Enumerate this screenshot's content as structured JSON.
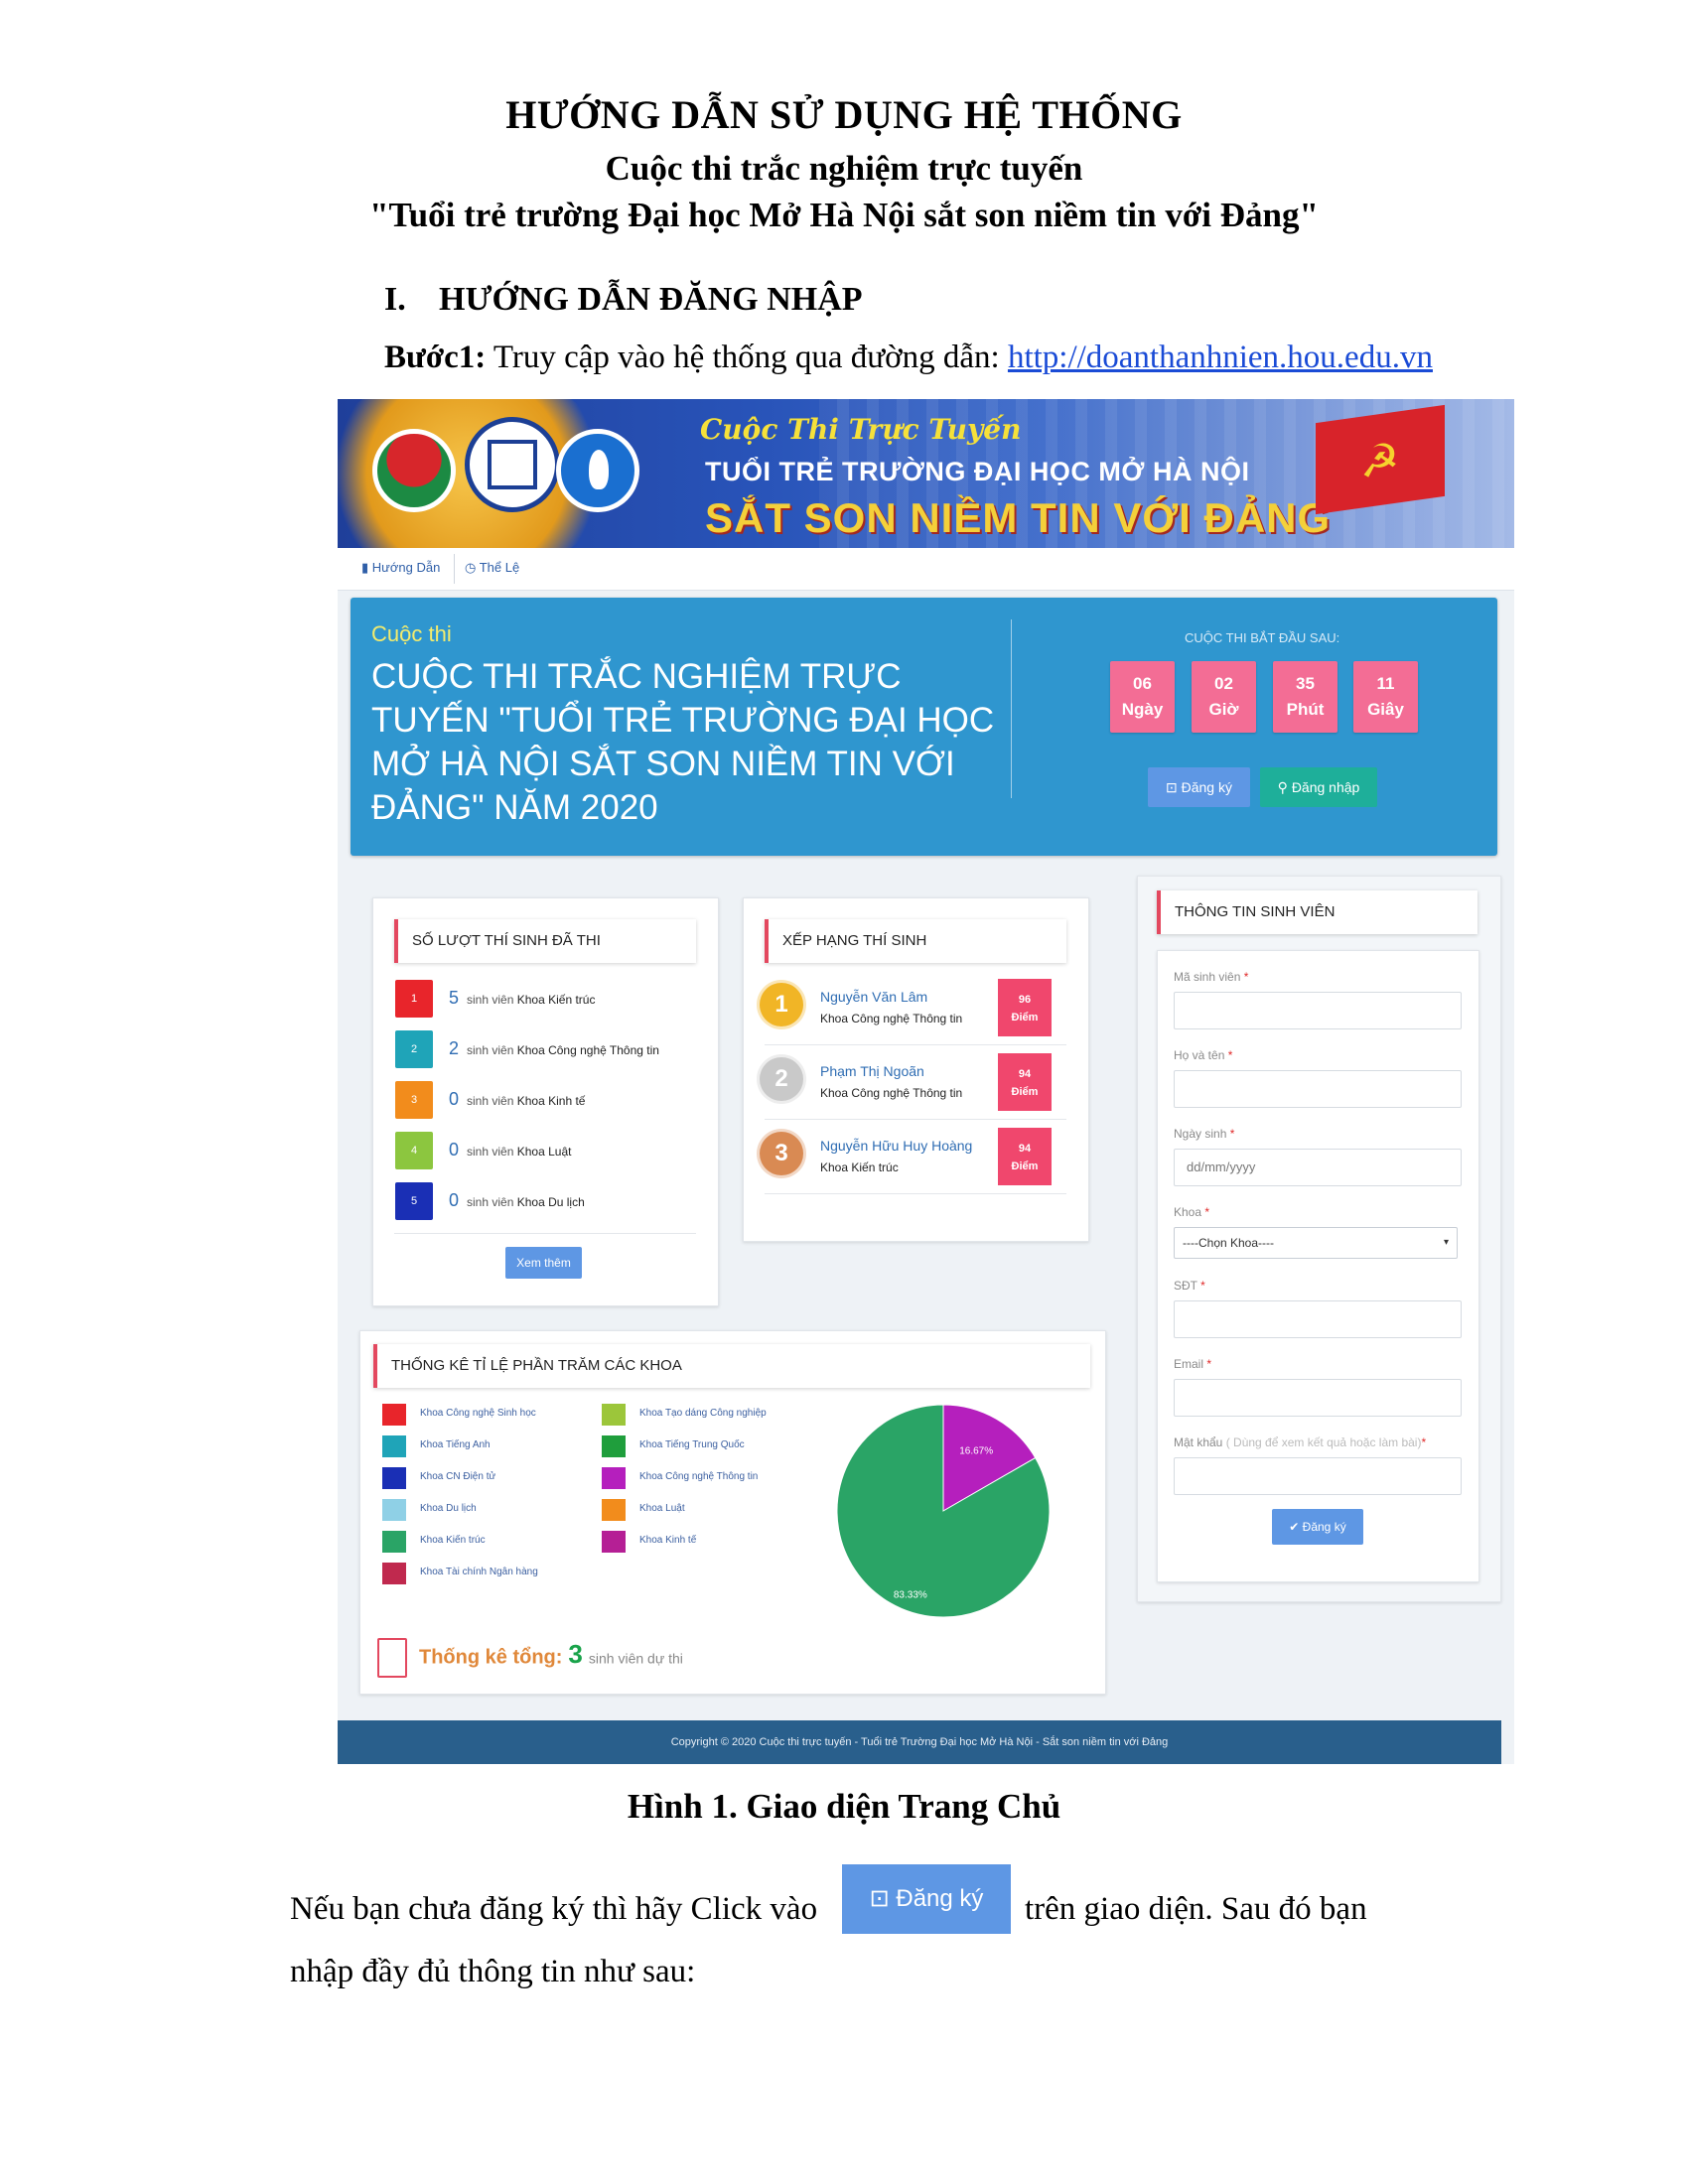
{
  "doc": {
    "title": "HƯỚNG DẪN SỬ DỤNG HỆ THỐNG",
    "subtitle": "Cuộc thi trắc nghiệm trực tuyến",
    "subtitle2": "\"Tuổi trẻ trường Đại học Mở Hà Nội sắt son niềm tin với Đảng\"",
    "section_num": "I.",
    "section_title": "HƯỚNG DẪN ĐĂNG NHẬP",
    "step_label": "Bước1:",
    "step_text": " Truy cập vào hệ thống qua đường dẫn: ",
    "step_link": "http://doanthanhnien.hou.edu.vn",
    "caption": "Hình  1. Giao diện Trang Chủ",
    "para1_a": "Nếu bạn chưa đăng ký thì hãy Click vào",
    "para1_b": "trên giao diện. Sau đó bạn",
    "para2": "nhập đầy đủ thông tin như sau:",
    "inline_button": "Đăng ký"
  },
  "banner": {
    "sub": "Cuộc Thi Trực Tuyến",
    "line1": "TUỔI TRẺ TRƯỜNG ĐẠI HỌC MỞ HÀ NỘI",
    "line2": "SẮT SON NIỀM TIN VỚI ĐẢNG"
  },
  "nav": {
    "guide": "Hướng Dẫn",
    "rules": "Thể Lệ"
  },
  "hero": {
    "label": "Cuộc thi",
    "title": "CUỘC THI TRẮC NGHIỆM TRỰC TUYẾN \"TUỔI TRẺ TRƯỜNG ĐẠI HỌC MỞ HÀ NỘI SẮT SON NIỀM TIN VỚI ĐẢNG\" NĂM 2020",
    "countdown_label": "CUỘC THI BẮT ĐẦU SAU:",
    "countdown": [
      {
        "value": "06",
        "unit": "Ngày"
      },
      {
        "value": "02",
        "unit": "Giờ"
      },
      {
        "value": "35",
        "unit": "Phút"
      },
      {
        "value": "11",
        "unit": "Giây"
      }
    ],
    "register": "Đăng ký",
    "login": "Đăng nhập"
  },
  "stats": {
    "title": "SỐ LƯỢT THÍ SINH ĐÃ THI",
    "unit": "sinh viên",
    "rows": [
      {
        "idx": "1",
        "count": "5",
        "faculty": "Khoa Kiến trúc",
        "color": "#e8252b"
      },
      {
        "idx": "2",
        "count": "2",
        "faculty": "Khoa Công nghệ Thông tin",
        "color": "#1fa4b8"
      },
      {
        "idx": "3",
        "count": "0",
        "faculty": "Khoa Kinh tế",
        "color": "#f28c1c"
      },
      {
        "idx": "4",
        "count": "0",
        "faculty": "Khoa Luật",
        "color": "#8cc63f"
      },
      {
        "idx": "5",
        "count": "0",
        "faculty": "Khoa Du lịch",
        "color": "#1a2fb5"
      }
    ],
    "more": "Xem thêm"
  },
  "ranking": {
    "title": "XẾP HẠNG THÍ SINH",
    "points_unit": "Điểm",
    "rows": [
      {
        "rank": "1",
        "name": "Nguyễn Văn Lâm",
        "faculty": "Khoa Công nghệ Thông tin",
        "score": "96",
        "color": "#f1b526"
      },
      {
        "rank": "2",
        "name": "Phạm Thị Ngoãn",
        "faculty": "Khoa Công nghệ Thông tin",
        "score": "94",
        "color": "#c9c9c9"
      },
      {
        "rank": "3",
        "name": "Nguyễn Hữu Huy Hoàng",
        "faculty": "Khoa Kiến trúc",
        "score": "94",
        "color": "#d98a53"
      }
    ]
  },
  "student": {
    "title": "THÔNG TIN SINH VIÊN",
    "fields": [
      {
        "label": "Mã sinh viên",
        "placeholder": ""
      },
      {
        "label": "Họ và tên",
        "placeholder": ""
      },
      {
        "label": "Ngày sinh",
        "placeholder": "dd/mm/yyyy"
      },
      {
        "label": "Khoa",
        "placeholder": "----Chọn Khoa----"
      },
      {
        "label": "SĐT",
        "placeholder": ""
      },
      {
        "label": "Email",
        "placeholder": ""
      },
      {
        "label": "Mật khẩu",
        "placeholder": ""
      }
    ],
    "password_hint": "( Dùng để xem kết quả hoặc làm bài)",
    "required_mark": "*",
    "submit": "Đăng ký"
  },
  "percent": {
    "title": "THỐNG KÊ TỈ LỆ PHẦN TRĂM CÁC KHOA",
    "legend": [
      {
        "label": "Khoa Công nghệ Sinh học",
        "color": "#e8252b"
      },
      {
        "label": "Khoa Tiếng Anh",
        "color": "#1fa4b8"
      },
      {
        "label": "Khoa CN Điện tử",
        "color": "#1a2fb5"
      },
      {
        "label": "Khoa Du lịch",
        "color": "#8fd0e6"
      },
      {
        "label": "Khoa Kiến trúc",
        "color": "#2aa466"
      },
      {
        "label": "Khoa Tài chính Ngân hàng",
        "color": "#c0294e"
      },
      {
        "label": "Khoa Tạo dáng Công nghiệp",
        "color": "#9cc63a"
      },
      {
        "label": "Khoa Tiếng Trung Quốc",
        "color": "#1f9e3c"
      },
      {
        "label": "Khoa Công nghệ Thông tin",
        "color": "#b51fbd"
      },
      {
        "label": "Khoa Luật",
        "color": "#f28c1c"
      },
      {
        "label": "Khoa Kinh tế",
        "color": "#b51f95"
      }
    ],
    "total_label": "Thống kê tổng:",
    "total_value": "3",
    "total_unit": "sinh viên dự thi"
  },
  "chart_data": {
    "type": "pie",
    "slices": [
      {
        "label": "Khoa Công nghệ Thông tin",
        "value": 16.67,
        "display": "16.67%",
        "color": "#b51fbd"
      },
      {
        "label": "Khoa Kiến trúc",
        "value": 83.33,
        "display": "83.33%",
        "color": "#2aa466"
      }
    ]
  },
  "footer": "Copyright © 2020 Cuộc thi trực tuyến - Tuổi trẻ Trường Đại học Mở Hà Nội - Sắt son niềm tin với Đảng"
}
